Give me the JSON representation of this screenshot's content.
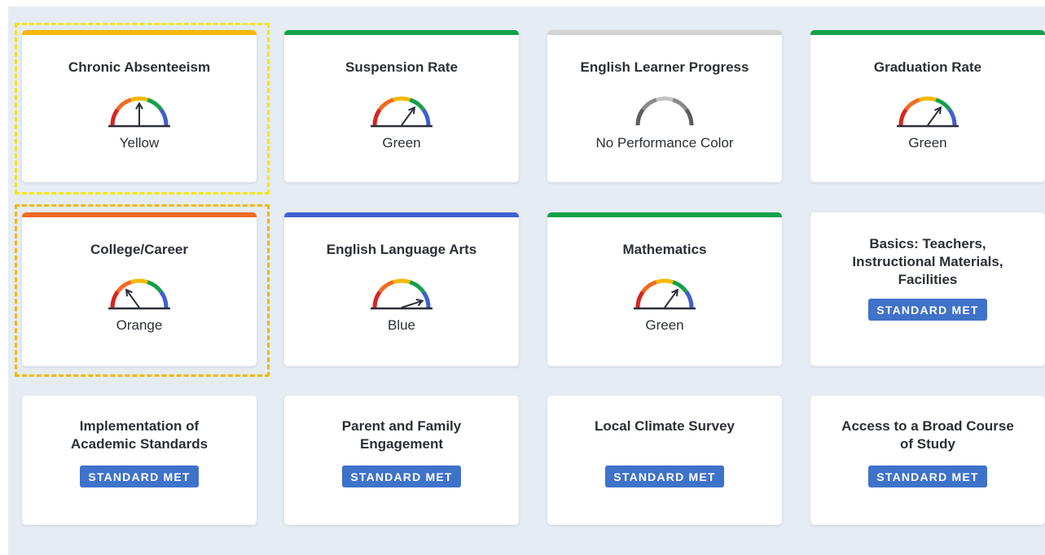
{
  "colors": {
    "yellow": "#f6b800",
    "orange": "#f26a21",
    "green": "#14a04a",
    "blue": "#3f5fd0",
    "red": "#d7261e",
    "gray": "#d3d3d3",
    "badge": "#3f72c9",
    "highlight_yellow": "#f7e600",
    "highlight_orange": "#f2b705"
  },
  "indicators": [
    {
      "title": "Chronic Absenteeism",
      "status": "Yellow",
      "performance_level": "yellow"
    },
    {
      "title": "Suspension Rate",
      "status": "Green",
      "performance_level": "green"
    },
    {
      "title": "English Learner Progress",
      "status": "No Performance Color",
      "performance_level": "none"
    },
    {
      "title": "Graduation Rate",
      "status": "Green",
      "performance_level": "green"
    },
    {
      "title": "College/Career",
      "status": "Orange",
      "performance_level": "orange"
    },
    {
      "title": "English Language Arts",
      "status": "Blue",
      "performance_level": "blue"
    },
    {
      "title": "Mathematics",
      "status": "Green",
      "performance_level": "green"
    }
  ],
  "local_indicators": [
    {
      "title_lines": [
        "Basics: Teachers,",
        "Instructional Materials,",
        "Facilities"
      ],
      "badge": "STANDARD MET"
    },
    {
      "title_lines": [
        "Implementation of",
        "Academic Standards"
      ],
      "badge": "STANDARD MET"
    },
    {
      "title_lines": [
        "Parent and Family",
        "Engagement"
      ],
      "badge": "STANDARD MET"
    },
    {
      "title_lines": [
        "Local Climate Survey"
      ],
      "badge": "STANDARD MET"
    },
    {
      "title_lines": [
        "Access to a Broad Course",
        "of Study"
      ],
      "badge": "STANDARD MET"
    }
  ]
}
